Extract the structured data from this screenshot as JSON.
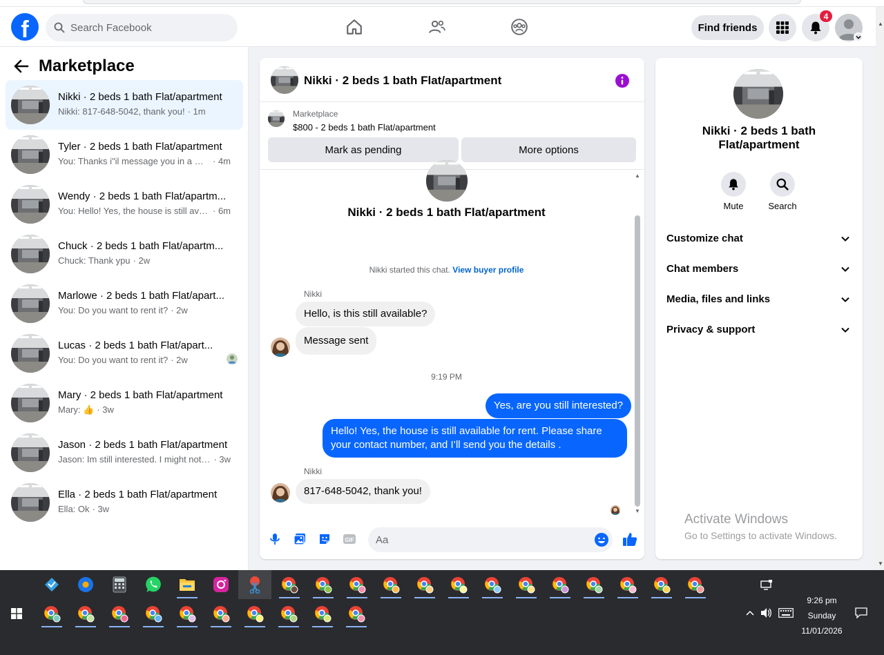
{
  "topbar": {
    "search_placeholder": "Search Facebook",
    "find_friends": "Find friends",
    "notification_count": "4"
  },
  "sidebar": {
    "title": "Marketplace",
    "conversations": [
      {
        "name": "Nikki · 2 beds 1 bath Flat/apartment",
        "preview": "Nikki: 817-648-5042, thank you!",
        "time": "· 1m",
        "active": true
      },
      {
        "name": "Tyler · 2 beds 1 bath Flat/apartment",
        "preview": "You: Thanks i\"il message you in a mo...",
        "time": "· 4m"
      },
      {
        "name": "Wendy · 2 beds 1 bath Flat/apartm...",
        "preview": "You: Hello! Yes, the house is still avail...",
        "time": "· 6m"
      },
      {
        "name": "Chuck · 2 beds 1 bath Flat/apartm...",
        "preview": "Chuck: Thank ypu",
        "time": "· 2w"
      },
      {
        "name": "Marlowe · 2 beds 1 bath Flat/apart...",
        "preview": "You: Do you want to rent it?",
        "time": "· 2w"
      },
      {
        "name": "Lucas · 2 beds 1 bath Flat/apart...",
        "preview": "You: Do you want to rent it?",
        "time": "· 2w"
      },
      {
        "name": "Mary · 2 beds 1 bath Flat/apartment",
        "preview": "Mary: 👍",
        "time": "· 3w"
      },
      {
        "name": "Jason · 2 beds 1 bath Flat/apartment",
        "preview": "Jason: Im still interested. I might not ...",
        "time": "· 3w"
      },
      {
        "name": "Ella · 2 beds 1 bath Flat/apartment",
        "preview": "Ella: Ok",
        "time": "· 3w"
      }
    ]
  },
  "chat": {
    "title": "Nikki · 2 beds 1 bath Flat/apartment",
    "listing_source": "Marketplace",
    "listing_price": "$800 - 2 beds 1 bath Flat/apartment",
    "mark_pending": "Mark as pending",
    "more_options": "More options",
    "intro_name": "Nikki · 2 beds 1 bath Flat/apartment",
    "started_text": "Nikki started this chat.",
    "view_profile": "View buyer profile",
    "sender": "Nikki",
    "msg1": "Hello, is this still available?",
    "msg2": "Message sent",
    "timestamp": "9:19 PM",
    "msg3": "Yes, are you still interested?",
    "msg4": "Hello! Yes, the house is still available for rent. Please share your contact number, and I’ll send you the details .",
    "sender2": "Nikki",
    "msg5": "817-648-5042, thank you!",
    "input_placeholder": "Aa"
  },
  "details": {
    "title": "Nikki · 2 beds 1 bath Flat/apartment",
    "mute": "Mute",
    "search": "Search",
    "sections": [
      "Customize chat",
      "Chat members",
      "Media, files and links",
      "Privacy & support"
    ]
  },
  "watermark": {
    "line1": "Activate Windows",
    "line2": "Go to Settings to activate Windows."
  },
  "taskbar": {
    "time": "9:26 pm",
    "day": "Sunday",
    "date": "11/01/2026"
  },
  "colors": {
    "brand": "#0866ff",
    "badge": "#e41e3f",
    "info": "#9b0fd1"
  }
}
